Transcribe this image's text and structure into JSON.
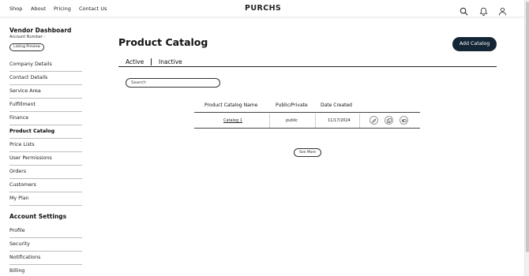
{
  "nav": {
    "links": [
      "Shop",
      "About",
      "Pricing",
      "Contact Us"
    ],
    "logo": "PURCHS",
    "icons": [
      "search-icon",
      "bell-icon",
      "user-icon"
    ]
  },
  "sidebar": {
    "title": "Vendor Dashboard",
    "account_number": "Account Number -",
    "listing_preview": "Listing Preview",
    "items": [
      "Company Details",
      "Contact Details",
      "Service Area",
      "Fulfillment",
      "Finance",
      "Product Catalog",
      "Price Lists",
      "User Permissions",
      "Orders",
      "Customers",
      "My Plan"
    ],
    "active_item": "Product Catalog",
    "settings_title": "Account Settings",
    "settings_items": [
      "Profile",
      "Security",
      "Notifications",
      "Billing"
    ]
  },
  "main": {
    "title": "Product Catalog",
    "add_button": "Add Catalog",
    "tabs": [
      "Active",
      "Inactive"
    ],
    "active_tab": "Active",
    "search_placeholder": "Search",
    "table": {
      "headers": [
        "Product Catalog Name",
        "Public/Private",
        "Date Created"
      ],
      "rows": [
        {
          "name": "Catalog 1",
          "visibility": "public",
          "date": "11/17/2024"
        }
      ],
      "row_action_icons": [
        "edit-icon",
        "copy-icon",
        "toggle-icon"
      ]
    },
    "see_more": "See More"
  },
  "colors": {
    "primary_button": "#142536",
    "text": "#1a1a1a",
    "divider": "#bdbdbd"
  }
}
